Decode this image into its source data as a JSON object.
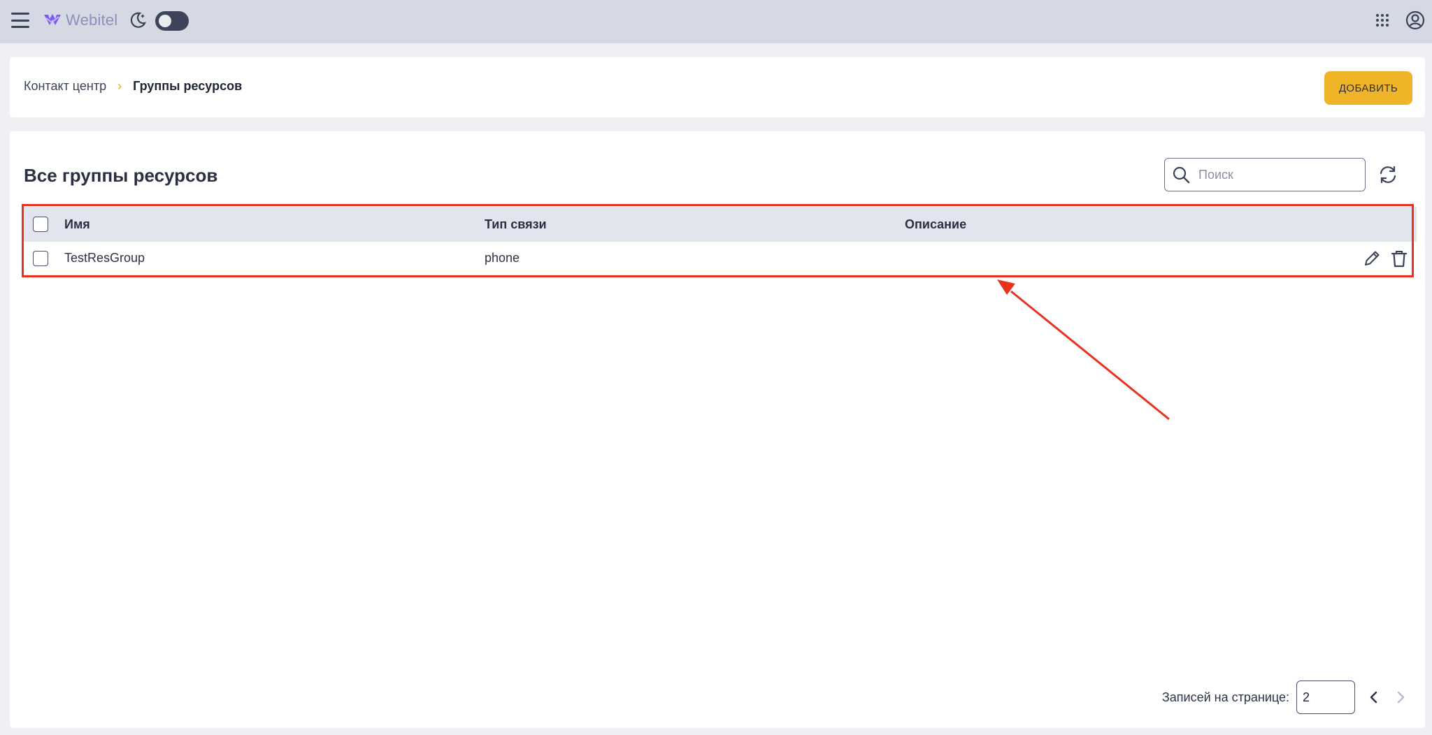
{
  "header": {
    "logo_text": "Webitel",
    "icons": [
      "menu-icon",
      "moon-icon",
      "apps-grid-icon",
      "account-icon"
    ]
  },
  "breadcrumb": {
    "parent": "Контакт центр",
    "separator": "›",
    "current": "Группы ресурсов"
  },
  "toolbar": {
    "add_label": "ДОБАВИТЬ"
  },
  "main": {
    "title": "Все группы ресурсов",
    "search": {
      "placeholder": "Поиск",
      "value": ""
    }
  },
  "table": {
    "columns": [
      "Имя",
      "Тип связи",
      "Описание"
    ],
    "rows": [
      {
        "name": "TestResGroup",
        "type": "phone",
        "description": ""
      }
    ]
  },
  "pagination": {
    "label": "Записей на странице:",
    "page_size": "2"
  },
  "colors": {
    "accent": "#f0b429",
    "annotation": "#e8321e",
    "header_bg": "#d5d9e4"
  }
}
